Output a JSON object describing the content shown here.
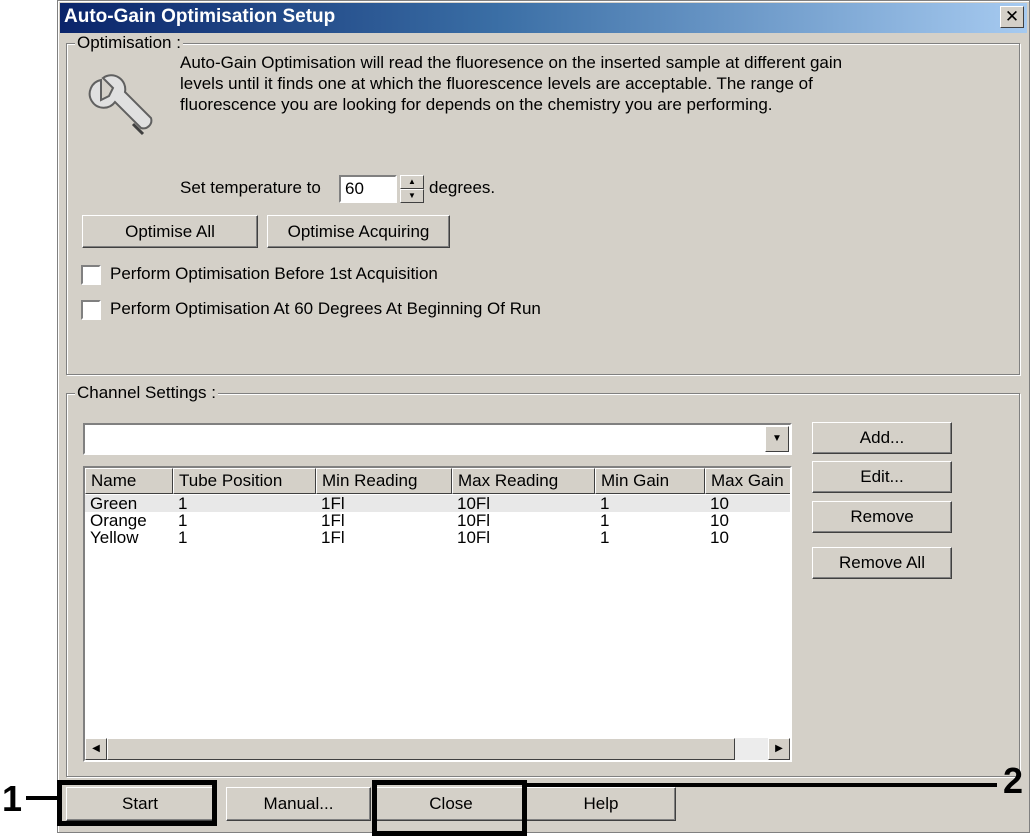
{
  "window": {
    "title": "Auto-Gain Optimisation Setup",
    "close_glyph": "✕"
  },
  "optimisation": {
    "legend": "Optimisation :",
    "description": "Auto-Gain Optimisation will read the fluoresence on the inserted sample at different gain levels until it finds one at which the fluorescence levels are acceptable. The range of fluorescence you are looking for depends on the chemistry you are performing.",
    "temp_prefix": "Set temperature to",
    "temp_value": "60",
    "temp_suffix": "degrees.",
    "optimise_all": "Optimise All",
    "optimise_acquiring": "Optimise Acquiring",
    "check_before": {
      "label": "Perform Optimisation Before 1st Acquisition",
      "checked": false
    },
    "check_at_60": {
      "label": "Perform Optimisation At 60 Degrees At Beginning Of Run",
      "checked": false
    }
  },
  "channel_settings": {
    "legend": "Channel Settings :",
    "combo_value": "",
    "columns": [
      "Name",
      "Tube Position",
      "Min Reading",
      "Max Reading",
      "Min Gain",
      "Max Gain"
    ],
    "rows": [
      [
        "Green",
        "1",
        "1Fl",
        "10Fl",
        "1",
        "10"
      ],
      [
        "Orange",
        "1",
        "1Fl",
        "10Fl",
        "1",
        "10"
      ],
      [
        "Yellow",
        "1",
        "1Fl",
        "10Fl",
        "1",
        "10"
      ]
    ],
    "selected_row": 0,
    "add": "Add...",
    "edit": "Edit...",
    "remove": "Remove",
    "remove_all": "Remove All"
  },
  "footer": {
    "start": "Start",
    "manual": "Manual...",
    "close": "Close",
    "help": "Help"
  },
  "annotations": {
    "label1": "1",
    "label2": "2"
  }
}
